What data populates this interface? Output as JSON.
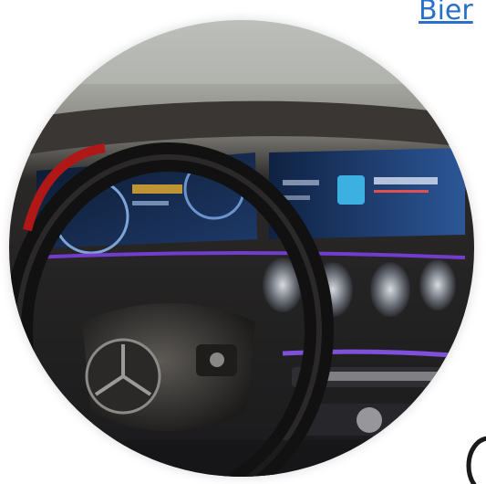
{
  "header": {
    "link_text": "Bier"
  },
  "photo": {
    "subject": "car-dashboard-interior",
    "accent_color": "#7b3fe0",
    "screen_color": "#3a6fb8"
  }
}
